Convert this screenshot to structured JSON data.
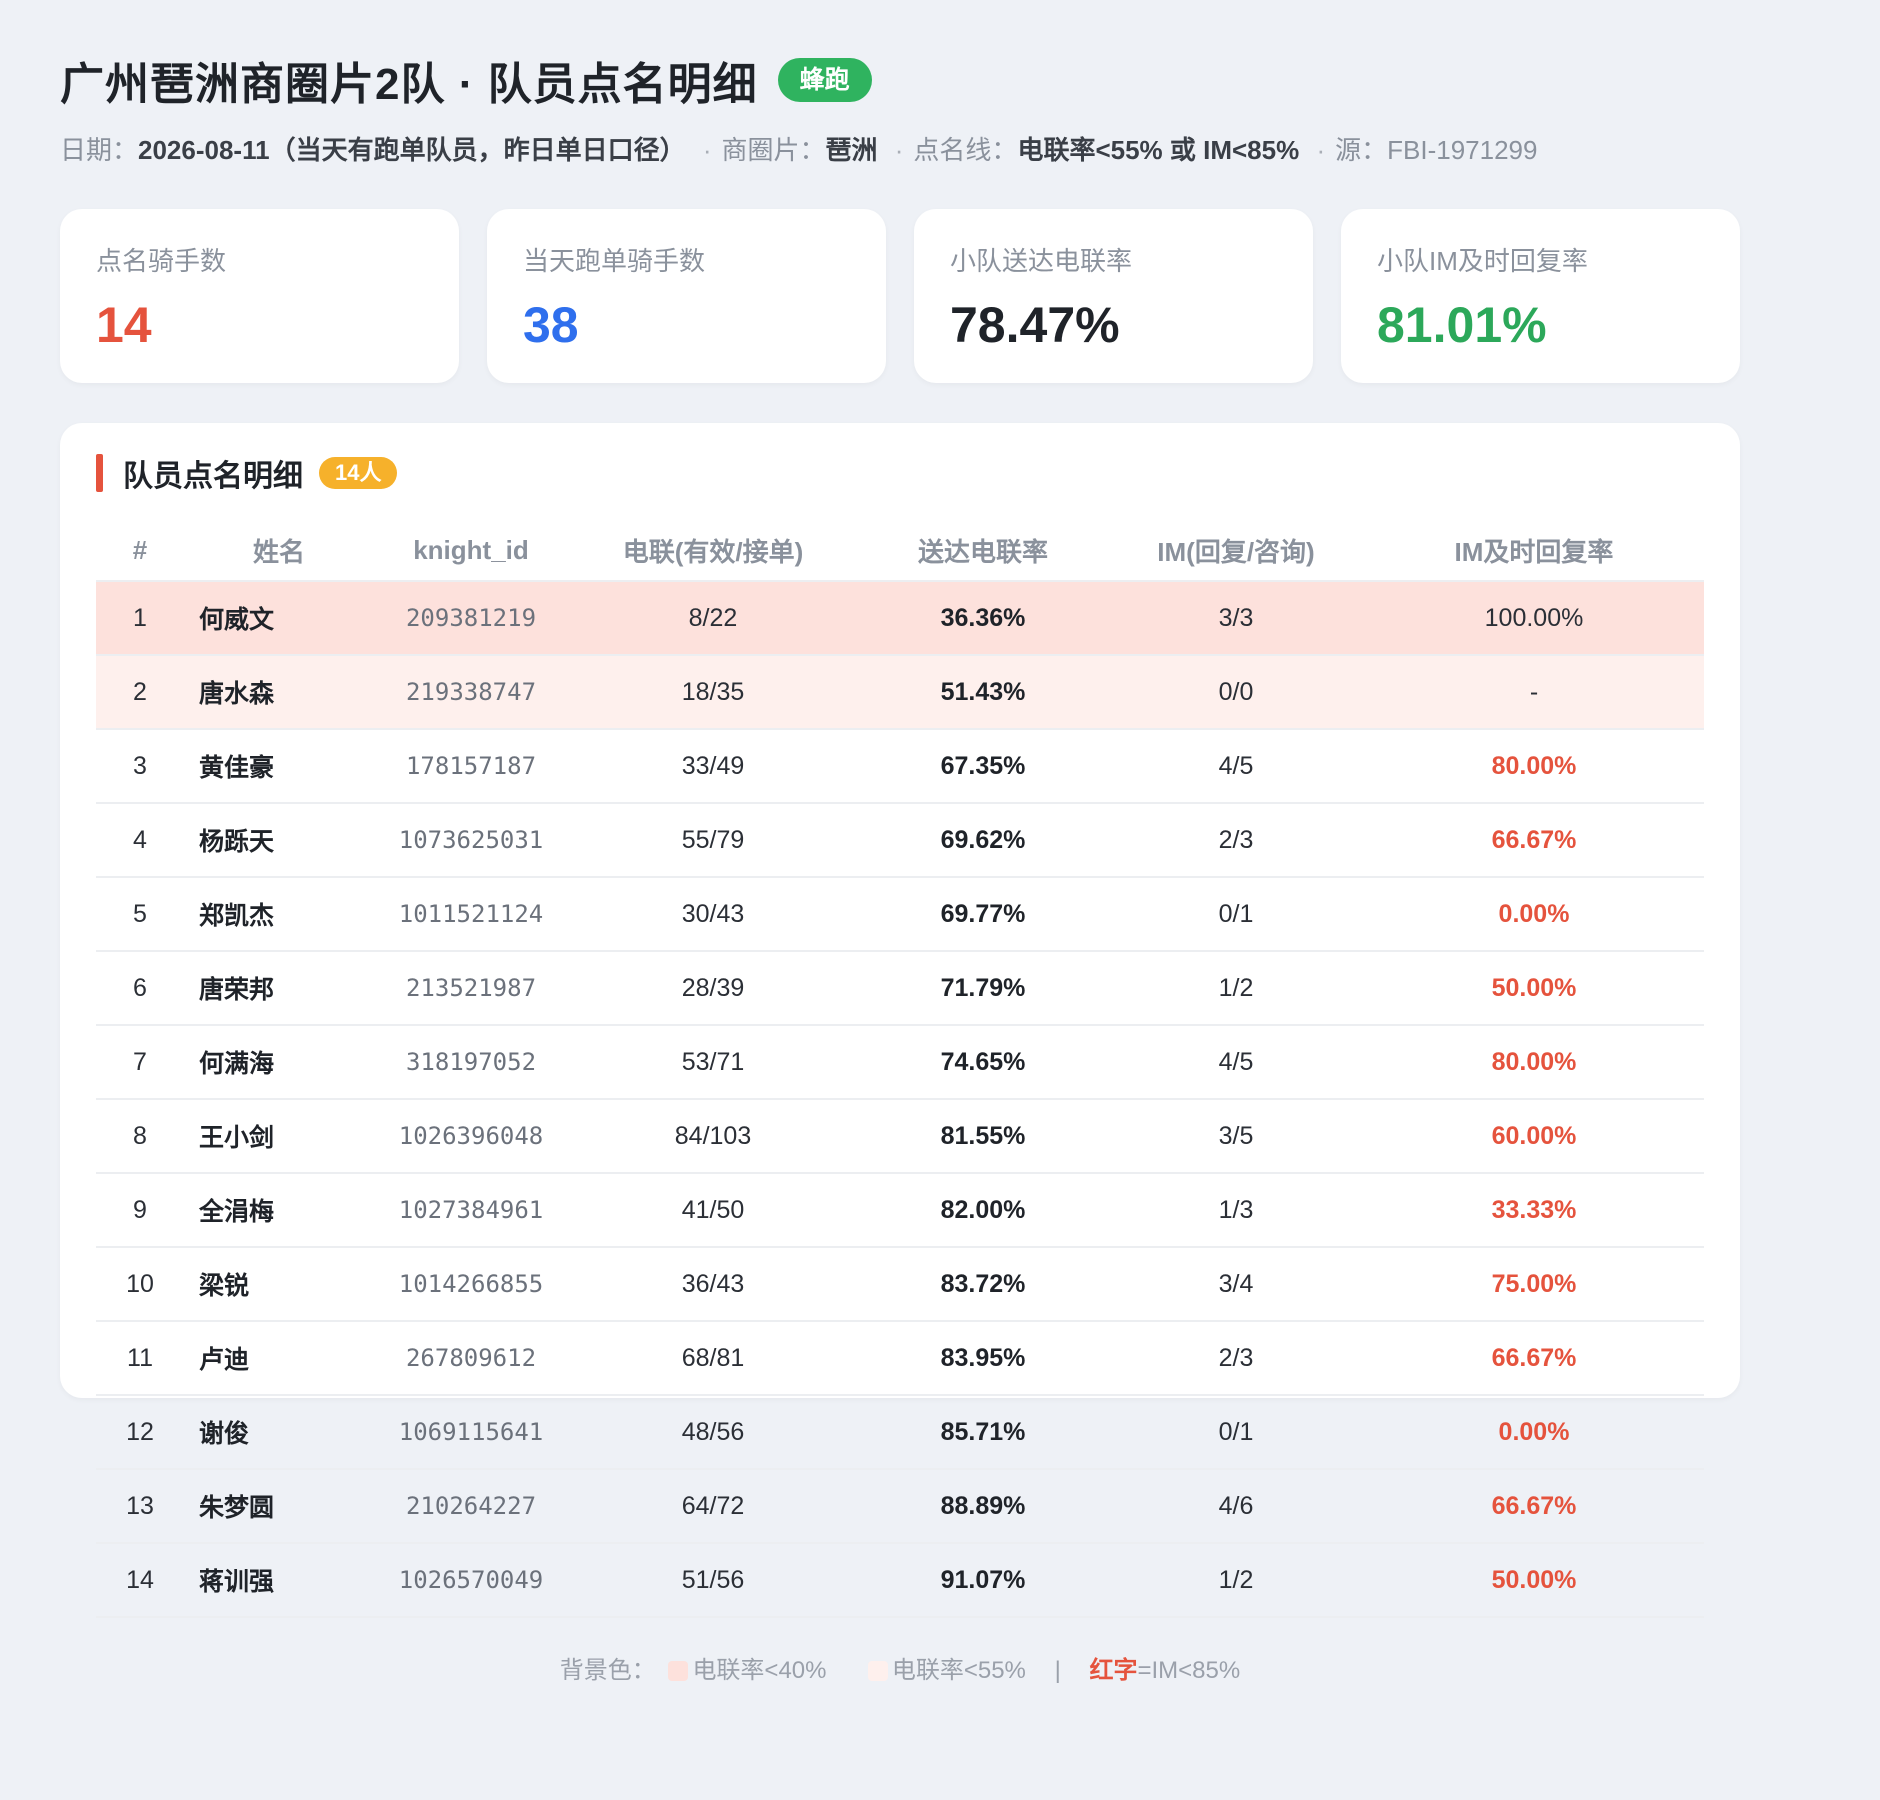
{
  "header": {
    "title": "广州琶洲商圈片2队 · 队员点名明细",
    "brand_badge": "蜂跑",
    "subtitle": {
      "date_label": "日期：",
      "date_value": "2026-08-11（当天有跑单队员，昨日单日口径）",
      "area_label": "商圈片：",
      "area_value": "琶洲",
      "line_label": "点名线：",
      "line_value": "电联率<55% 或 IM<85%",
      "source_label": "源：",
      "source_value": "FBI-1971299",
      "separator": "·"
    }
  },
  "stats": [
    {
      "label": "点名骑手数",
      "value": "14",
      "color": "#e5533d"
    },
    {
      "label": "当天跑单骑手数",
      "value": "38",
      "color": "#2f6fed"
    },
    {
      "label": "小队送达电联率",
      "value": "78.47%",
      "color": "#1f2329"
    },
    {
      "label": "小队IM及时回复率",
      "value": "81.01%",
      "color": "#2ca85a"
    }
  ],
  "table": {
    "section_title": "队员点名明细",
    "count_badge": "14人",
    "columns": [
      "#",
      "姓名",
      "knight_id",
      "电联(有效/接单)",
      "送达电联率",
      "IM(回复/咨询)",
      "IM及时回复率"
    ],
    "rows": [
      {
        "no": "1",
        "name": "何威文",
        "knight_id": "209381219",
        "call": "8/22",
        "call_rate": "36.36%",
        "im": "3/3",
        "im_rate": "100.00%"
      },
      {
        "no": "2",
        "name": "唐水森",
        "knight_id": "219338747",
        "call": "18/35",
        "call_rate": "51.43%",
        "im": "0/0",
        "im_rate": "-"
      },
      {
        "no": "3",
        "name": "黄佳豪",
        "knight_id": "178157187",
        "call": "33/49",
        "call_rate": "67.35%",
        "im": "4/5",
        "im_rate": "80.00%"
      },
      {
        "no": "4",
        "name": "杨跞天",
        "knight_id": "1073625031",
        "call": "55/79",
        "call_rate": "69.62%",
        "im": "2/3",
        "im_rate": "66.67%"
      },
      {
        "no": "5",
        "name": "郑凯杰",
        "knight_id": "1011521124",
        "call": "30/43",
        "call_rate": "69.77%",
        "im": "0/1",
        "im_rate": "0.00%"
      },
      {
        "no": "6",
        "name": "唐荣邦",
        "knight_id": "213521987",
        "call": "28/39",
        "call_rate": "71.79%",
        "im": "1/2",
        "im_rate": "50.00%"
      },
      {
        "no": "7",
        "name": "何满海",
        "knight_id": "318197052",
        "call": "53/71",
        "call_rate": "74.65%",
        "im": "4/5",
        "im_rate": "80.00%"
      },
      {
        "no": "8",
        "name": "王小剑",
        "knight_id": "1026396048",
        "call": "84/103",
        "call_rate": "81.55%",
        "im": "3/5",
        "im_rate": "60.00%"
      },
      {
        "no": "9",
        "name": "全涓梅",
        "knight_id": "1027384961",
        "call": "41/50",
        "call_rate": "82.00%",
        "im": "1/3",
        "im_rate": "33.33%"
      },
      {
        "no": "10",
        "name": "梁锐",
        "knight_id": "1014266855",
        "call": "36/43",
        "call_rate": "83.72%",
        "im": "3/4",
        "im_rate": "75.00%"
      },
      {
        "no": "11",
        "name": "卢迪",
        "knight_id": "267809612",
        "call": "68/81",
        "call_rate": "83.95%",
        "im": "2/3",
        "im_rate": "66.67%"
      },
      {
        "no": "12",
        "name": "谢俊",
        "knight_id": "1069115641",
        "call": "48/56",
        "call_rate": "85.71%",
        "im": "0/1",
        "im_rate": "0.00%"
      },
      {
        "no": "13",
        "name": "朱梦圆",
        "knight_id": "210264227",
        "call": "64/72",
        "call_rate": "88.89%",
        "im": "4/6",
        "im_rate": "66.67%"
      },
      {
        "no": "14",
        "name": "蒋训强",
        "knight_id": "1026570049",
        "call": "51/56",
        "call_rate": "91.07%",
        "im": "1/2",
        "im_rate": "50.00%"
      }
    ]
  },
  "legend": {
    "prefix": "背景色：",
    "severe_label": "电联率<40%",
    "warn_label": "电联率<55%",
    "pipe": "|",
    "red_word": "红字",
    "red_rule": "=IM<85%"
  },
  "colors": {
    "severe_bg": "#fde1dc",
    "warn_bg": "#fef0ed",
    "alert_red": "#e5533d",
    "brand_green": "#2fb35f",
    "badge_orange": "#f6b12b"
  }
}
